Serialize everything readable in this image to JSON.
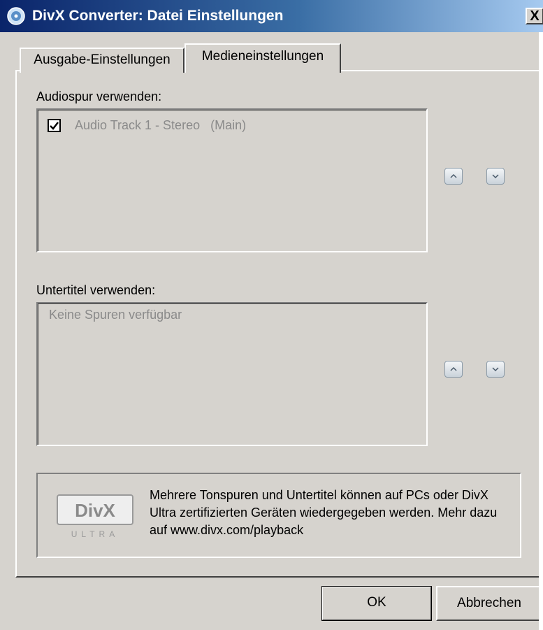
{
  "window": {
    "title": "DivX Converter: Datei Einstellungen",
    "close_label": "X"
  },
  "tabs": [
    {
      "label": "Ausgabe-Einstellungen",
      "active": false
    },
    {
      "label": "Medieneinstellungen",
      "active": true
    }
  ],
  "audio": {
    "label": "Audiospur verwenden:",
    "tracks": [
      {
        "label": "Audio Track 1 - Stereo   (Main)",
        "checked": true
      }
    ]
  },
  "subtitles": {
    "label": "Untertitel verwenden:",
    "empty_text": "Keine Spuren verfügbar"
  },
  "info": {
    "logo_text": "DivX",
    "logo_subtext": "ULTRA",
    "text": "Mehrere Tonspuren und Untertitel können auf PCs oder DivX Ultra zertifizierten Geräten wiedergegeben werden. Mehr dazu auf www.divx.com/playback"
  },
  "buttons": {
    "ok": "OK",
    "cancel": "Abbrechen"
  }
}
